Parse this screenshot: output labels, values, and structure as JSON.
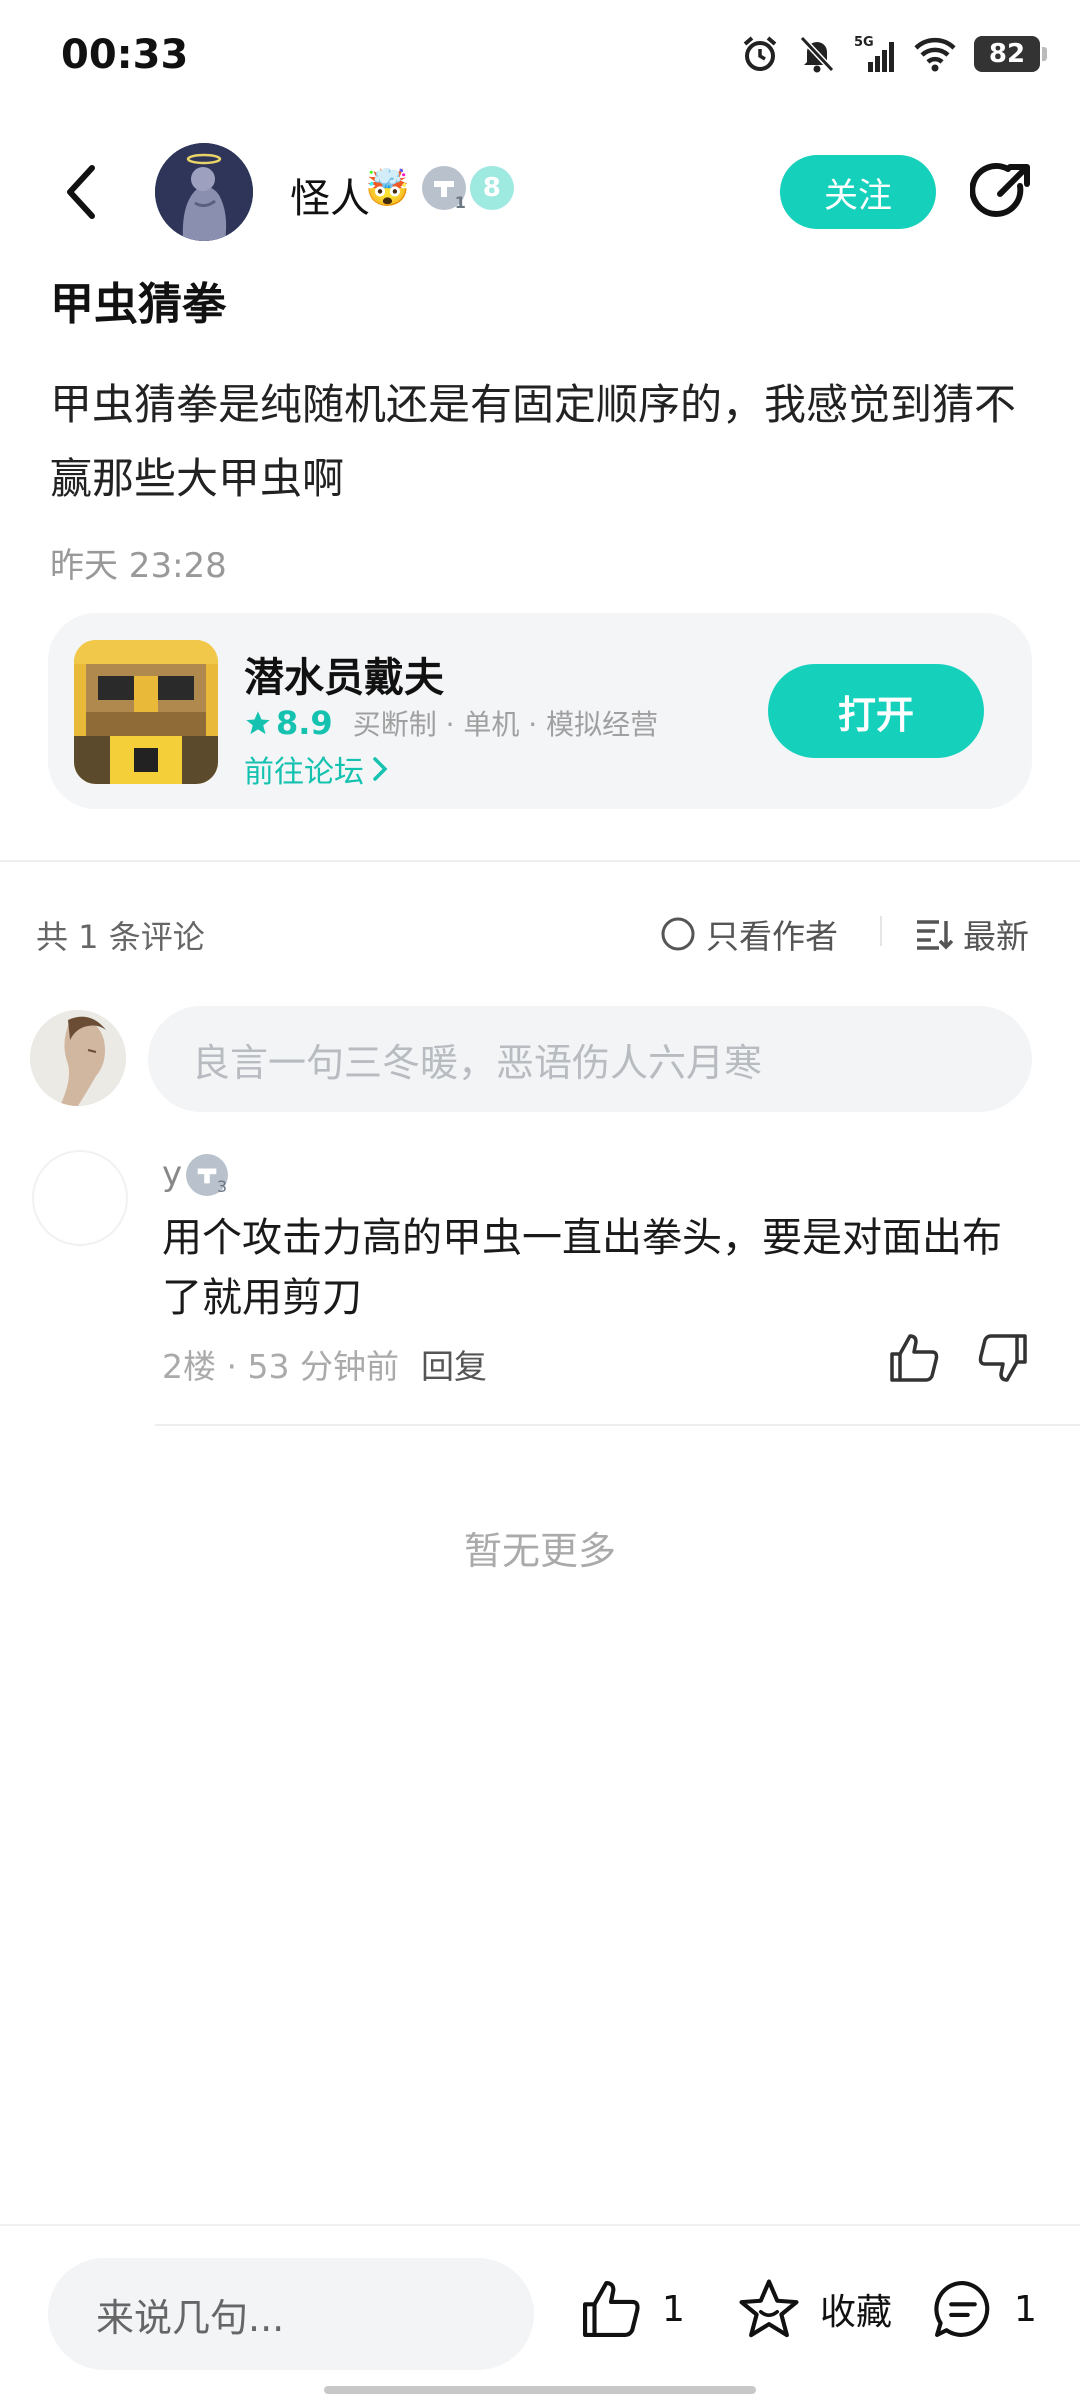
{
  "status_bar": {
    "time": "00:33",
    "battery": "82",
    "network": "5G"
  },
  "header": {
    "back_icon": "chevron-left-icon",
    "user_name": "怪人",
    "user_emoji": "🤯",
    "level_badge_small": "1",
    "level_badge_big": "8",
    "follow_label": "关注",
    "share_icon": "share-icon"
  },
  "post": {
    "title": "甲虫猜拳",
    "body": "甲虫猜拳是纯随机还是有固定顺序的，我感觉到猜不赢那些大甲虫啊",
    "time": "昨天 23:28"
  },
  "game_card": {
    "name": "潜水员戴夫",
    "score": "8.9",
    "tags": "买断制 · 单机 · 模拟经营",
    "forum_link": "前往论坛",
    "open_label": "打开"
  },
  "comments_header": {
    "count": "共 1 条评论",
    "only_author": "只看作者",
    "sort": "最新"
  },
  "comment_input": {
    "placeholder": "良言一句三冬暖，恶语伤人六月寒"
  },
  "comments": [
    {
      "name": "y",
      "level": "3",
      "text": "用个攻击力高的甲虫一直出拳头，要是对面出布了就用剪刀",
      "floor": "2楼",
      "time": "53 分钟前",
      "reply": "回复"
    }
  ],
  "footer_note": "暂无更多",
  "bottom_bar": {
    "input_placeholder": "来说几句...",
    "like_count": "1",
    "favorite_label": "收藏",
    "comment_count": "1"
  },
  "colors": {
    "accent": "#15d0bb",
    "accent_text": "#15c2b0"
  }
}
